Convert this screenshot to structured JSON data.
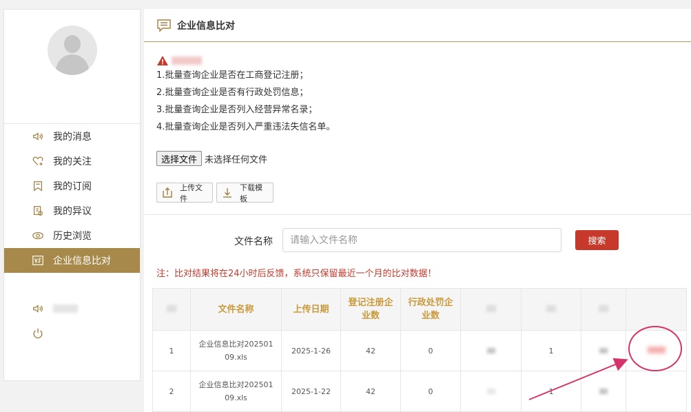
{
  "sidebar": {
    "menu": [
      {
        "label": "我的消息",
        "icon": "speaker-icon"
      },
      {
        "label": "我的关注",
        "icon": "heart-plus-icon"
      },
      {
        "label": "我的订阅",
        "icon": "bookmark-icon"
      },
      {
        "label": "我的异议",
        "icon": "document-icon"
      },
      {
        "label": "历史浏览",
        "icon": "eye-icon"
      },
      {
        "label": "企业信息比对",
        "icon": "vs-icon",
        "active": true
      }
    ],
    "extra_menu": [
      {
        "label": "",
        "icon": "speaker-icon"
      },
      {
        "label": "",
        "icon": "power-icon"
      }
    ]
  },
  "header": {
    "title": "企业信息比对"
  },
  "notice": {
    "lines": [
      "1.批量查询企业是否在工商登记注册；",
      "2.批量查询企业是否有行政处罚信息；",
      "3.批量查询企业是否列入经营异常名录；",
      "4.批量查询企业是否列入严重违法失信名单。"
    ]
  },
  "file_picker": {
    "button": "选择文件",
    "status": "未选择任何文件"
  },
  "toolbar": {
    "upload": "上传文件",
    "download": "下载模板"
  },
  "search": {
    "label": "文件名称",
    "placeholder": "请输入文件名称",
    "button": "搜索"
  },
  "note": "注：比对结果将在24小时后反馈，系统只保留最近一个月的比对数据！",
  "table": {
    "headers": [
      "",
      "文件名称",
      "上传日期",
      "登记注册企业数",
      "行政处罚企业数",
      "",
      "",
      "",
      ""
    ],
    "rows": [
      [
        "1",
        "企业信息比对20250109.xls",
        "2025-1-26",
        "42",
        "0",
        "",
        "1",
        "",
        ""
      ],
      [
        "2",
        "企业信息比对20250109.xls",
        "2025-1-22",
        "42",
        "0",
        "",
        "1",
        "",
        ""
      ]
    ]
  },
  "colors": {
    "accent": "#a78a4b",
    "danger": "#c7392b",
    "header_text": "#c99a3c",
    "annotation": "#d6336c"
  }
}
